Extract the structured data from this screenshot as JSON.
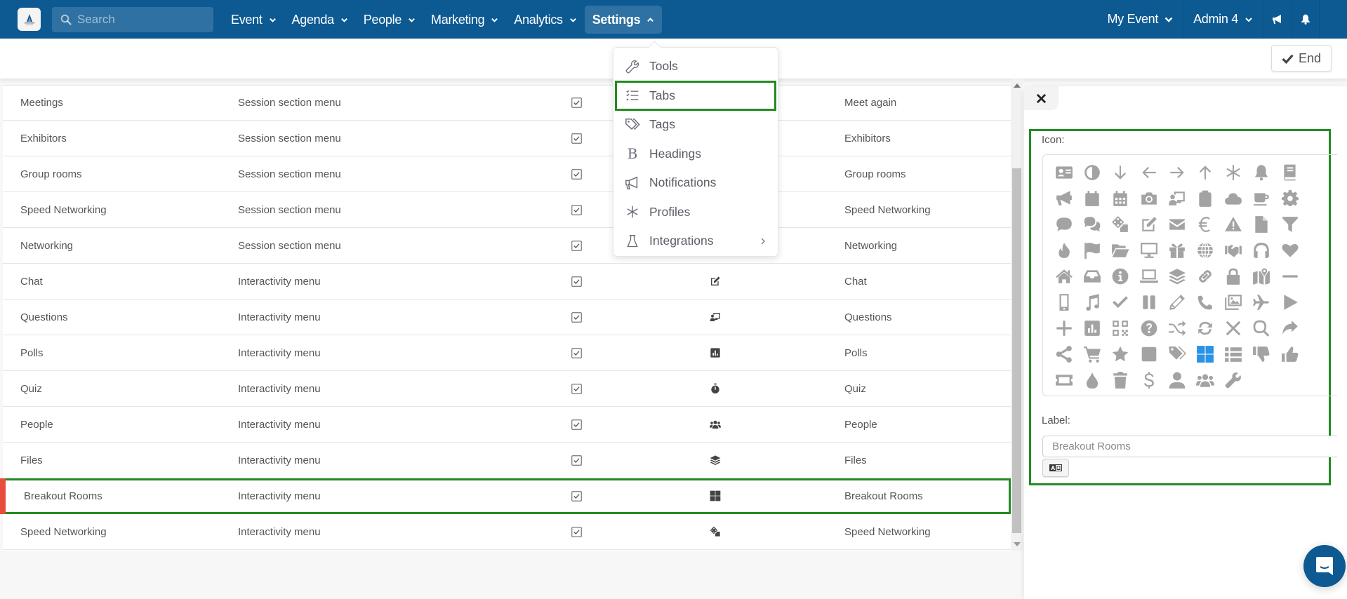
{
  "topbar": {
    "logo": "event-logo",
    "search_placeholder": "Search",
    "nav": [
      {
        "label": "Event",
        "icon": "chevron-down-icon"
      },
      {
        "label": "Agenda",
        "icon": "chevron-down-icon"
      },
      {
        "label": "People",
        "icon": "chevron-down-icon"
      },
      {
        "label": "Marketing",
        "icon": "chevron-down-icon"
      },
      {
        "label": "Analytics",
        "icon": "chevron-down-icon"
      },
      {
        "label": "Settings",
        "icon": "chevron-up-icon",
        "active": true
      }
    ],
    "right": {
      "event_selector": "My Event",
      "user": "Admin 4",
      "announcements_icon": "megaphone-icon",
      "notifications_icon": "bell-icon"
    }
  },
  "subbar": {
    "end_label": "End",
    "end_icon": "check-icon"
  },
  "settings_menu": {
    "items": [
      {
        "label": "Tools",
        "icon": "wrench-icon"
      },
      {
        "label": "Tabs",
        "icon": "list-check-icon",
        "highlighted": true
      },
      {
        "label": "Tags",
        "icon": "tags-icon"
      },
      {
        "label": "Headings",
        "icon": "bold-icon"
      },
      {
        "label": "Notifications",
        "icon": "megaphone-icon"
      },
      {
        "label": "Profiles",
        "icon": "asterisk-icon"
      },
      {
        "label": "Integrations",
        "icon": "flask-icon",
        "has_submenu": true
      }
    ]
  },
  "tabs_table": {
    "rows": [
      {
        "name": "Meetings",
        "section": "Session section menu",
        "enabled": true,
        "icon": "",
        "label": "Meet again"
      },
      {
        "name": "Exhibitors",
        "section": "Session section menu",
        "enabled": true,
        "icon": "",
        "label": "Exhibitors"
      },
      {
        "name": "Group rooms",
        "section": "Session section menu",
        "enabled": true,
        "icon": "",
        "label": "Group rooms"
      },
      {
        "name": "Speed Networking",
        "section": "Session section menu",
        "enabled": true,
        "icon": "",
        "label": "Speed Networking"
      },
      {
        "name": "Networking",
        "section": "Session section menu",
        "enabled": true,
        "icon": "",
        "label": "Networking"
      },
      {
        "name": "Chat",
        "section": "Interactivity menu",
        "enabled": true,
        "icon": "edit-icon",
        "label": "Chat"
      },
      {
        "name": "Questions",
        "section": "Interactivity menu",
        "enabled": true,
        "icon": "presenter-icon",
        "label": "Questions"
      },
      {
        "name": "Polls",
        "section": "Interactivity menu",
        "enabled": true,
        "icon": "chart-icon",
        "label": "Polls"
      },
      {
        "name": "Quiz",
        "section": "Interactivity menu",
        "enabled": true,
        "icon": "stopwatch-icon",
        "label": "Quiz"
      },
      {
        "name": "People",
        "section": "Interactivity menu",
        "enabled": true,
        "icon": "users-icon",
        "label": "People"
      },
      {
        "name": "Files",
        "section": "Interactivity menu",
        "enabled": true,
        "icon": "layers-icon",
        "label": "Files"
      },
      {
        "name": "Breakout Rooms",
        "section": "Interactivity menu",
        "enabled": true,
        "icon": "grid-icon",
        "label": "Breakout Rooms",
        "selected": true
      },
      {
        "name": "Speed Networking",
        "section": "Interactivity menu",
        "enabled": true,
        "icon": "dice-icon",
        "label": "Speed Networking"
      }
    ]
  },
  "edit_panel": {
    "close_icon": "close-icon",
    "icon_label": "Icon:",
    "icons": [
      "id-card",
      "adjust",
      "arrow-down",
      "arrow-left",
      "arrow-right",
      "arrow-up",
      "asterisk",
      "bell",
      "book",
      "bullhorn",
      "calendar",
      "calendar-grid",
      "camera",
      "presenter",
      "clipboard",
      "cloud",
      "coffee",
      "cog",
      "comment",
      "comments",
      "dice",
      "edit",
      "envelope",
      "euro",
      "warning",
      "file",
      "filter",
      "fire",
      "flag",
      "folder-open",
      "desktop",
      "gift",
      "globe",
      "handshake",
      "headphones",
      "heart",
      "home",
      "inbox",
      "info",
      "laptop",
      "layers",
      "link",
      "lock",
      "map-marked",
      "minus",
      "mobile",
      "music",
      "check",
      "pause",
      "pencil",
      "phone",
      "images",
      "plane",
      "play",
      "plus",
      "chart",
      "qrcode",
      "question",
      "random",
      "sync",
      "times",
      "search",
      "share",
      "share-nodes",
      "cart",
      "star",
      "stop",
      "tags",
      "grid",
      "list",
      "thumbs-down",
      "thumbs-up",
      "ticket",
      "tint",
      "trash",
      "dollar",
      "user",
      "users",
      "wrench"
    ],
    "selected_icon": "grid",
    "label_label": "Label:",
    "label_value": "Breakout Rooms",
    "translate_icon": "translate-icon"
  },
  "chat_widget": {
    "icon": "chat-bubble-icon"
  },
  "colors": {
    "brand": "#0d5a93",
    "highlight": "#228b22",
    "selected_icon": "#2a93e6",
    "row_marker": "#e74c3c"
  }
}
